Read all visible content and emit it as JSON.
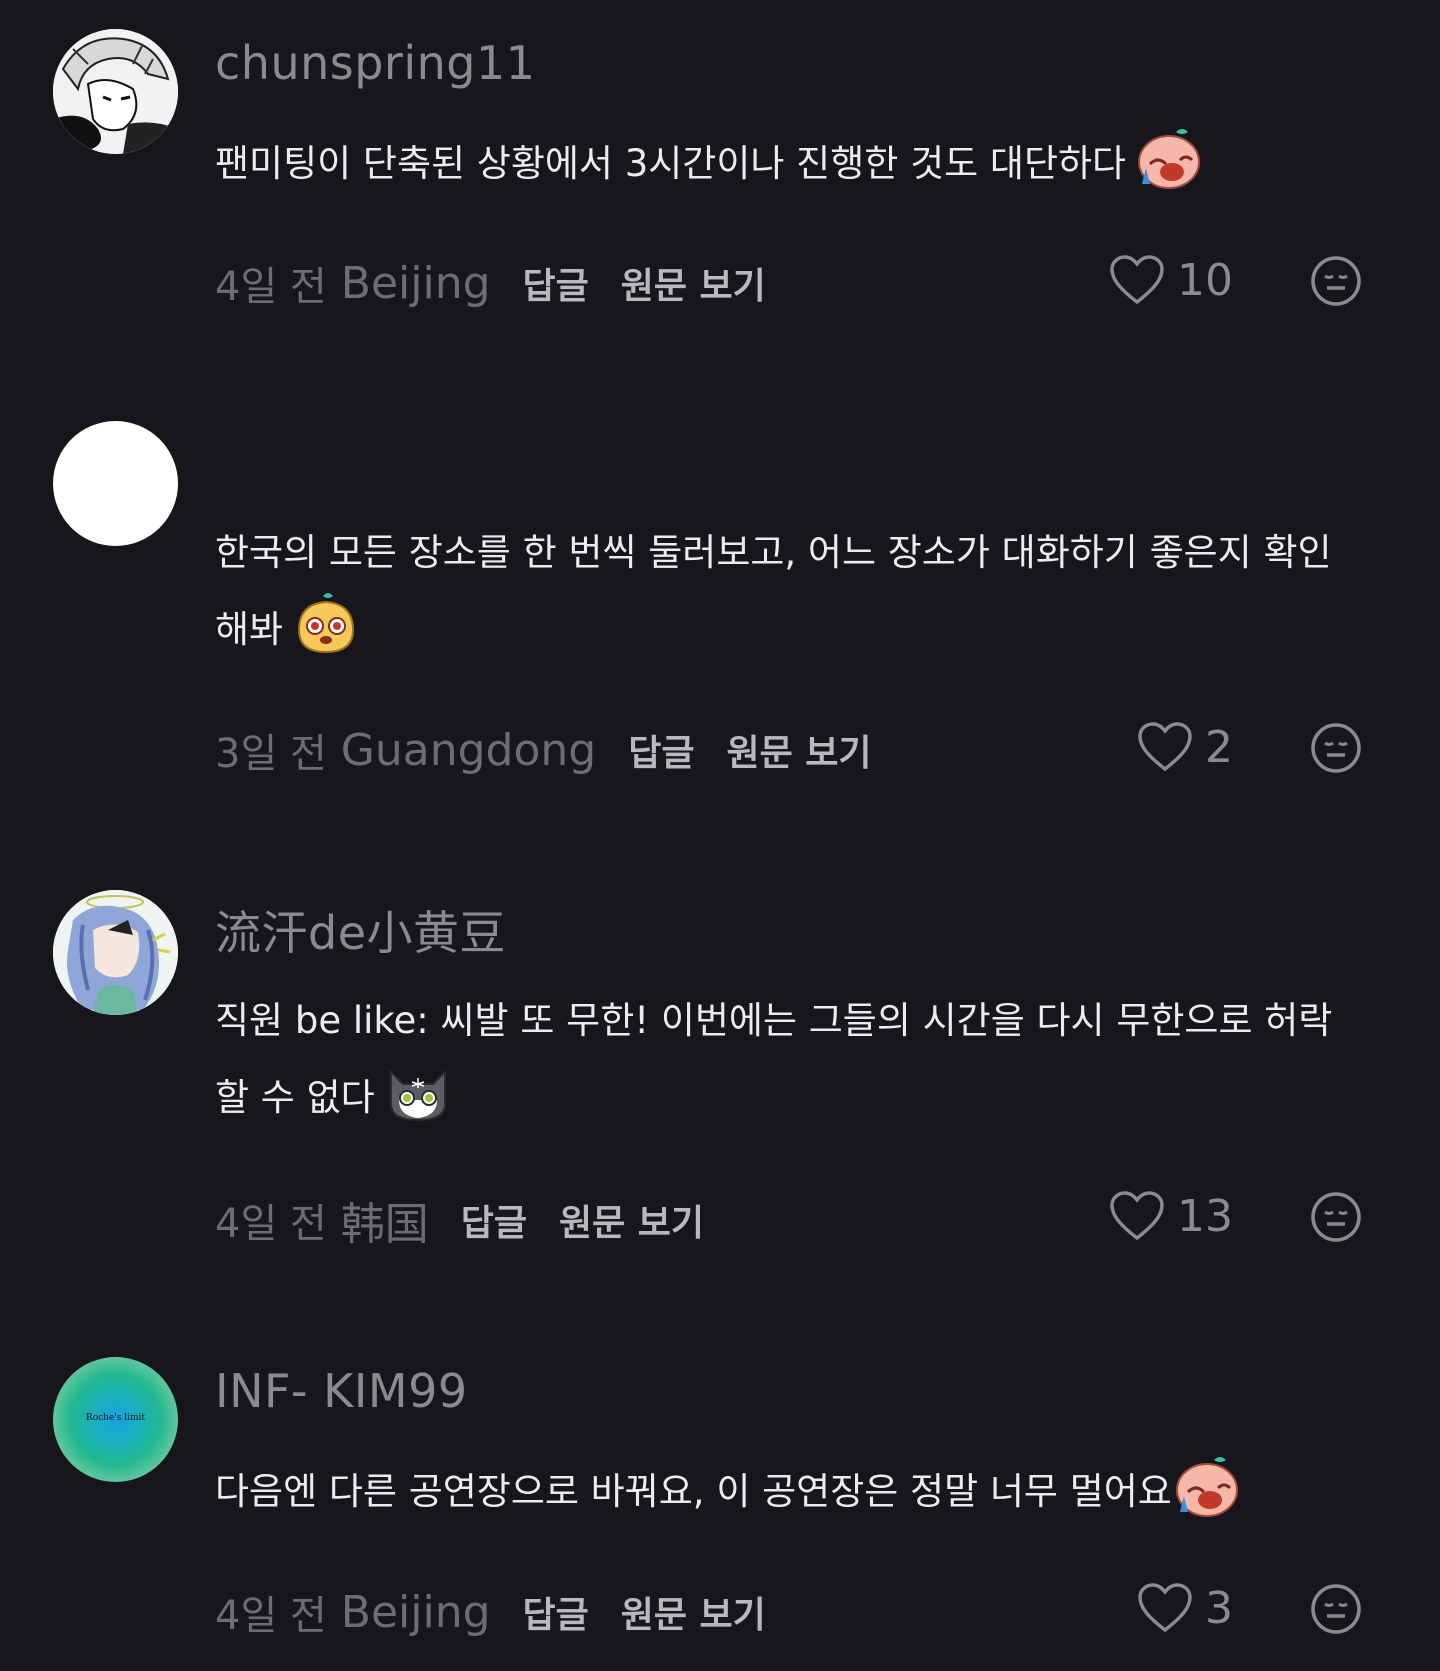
{
  "comments": [
    {
      "username": "chunspring11",
      "text": "팬미팅이 단축된 상황에서 3시간이나 진행한 것도 대단하다",
      "time_ago": "4일 전",
      "location": "Beijing",
      "reply_label": "답글",
      "view_original_label": "원문 보기",
      "likes": "10",
      "emoji_icon": "crying-face-sticker-icon"
    },
    {
      "username": "",
      "text": "한국의 모든 장소를 한 번씩 둘러보고, 어느 장소가 대화하기 좋은지 확인해봐",
      "time_ago": "3일 전",
      "location": "Guangdong",
      "reply_label": "답글",
      "view_original_label": "원문 보기",
      "likes": "2",
      "emoji_icon": "surprised-dog-sticker-icon"
    },
    {
      "username": "流汗de小黄豆",
      "text": "직원 be like: 씨발 또 무한! 이번에는 그들의 시간을 다시 무한으로 허락할 수 없다",
      "time_ago": "4일 전",
      "location": "韩国",
      "reply_label": "답글",
      "view_original_label": "원문 보기",
      "likes": "13",
      "emoji_icon": "shocked-cat-sticker-icon"
    },
    {
      "username": "INF- KIM99",
      "text": "다음엔 다른 공연장으로 바꿔요, 이 공연장은 정말 너무 멀어요",
      "time_ago": "4일 전",
      "location": "Beijing",
      "reply_label": "답글",
      "view_original_label": "원문 보기",
      "likes": "3",
      "emoji_icon": "crying-face-sticker-icon",
      "avatar_text": "Roche's limit"
    }
  ],
  "colors": {
    "background": "#16161c",
    "username": "#8a8a90",
    "body_text": "#ececf0",
    "meta_text": "#6c6c72",
    "action_text": "#b8b8be"
  }
}
